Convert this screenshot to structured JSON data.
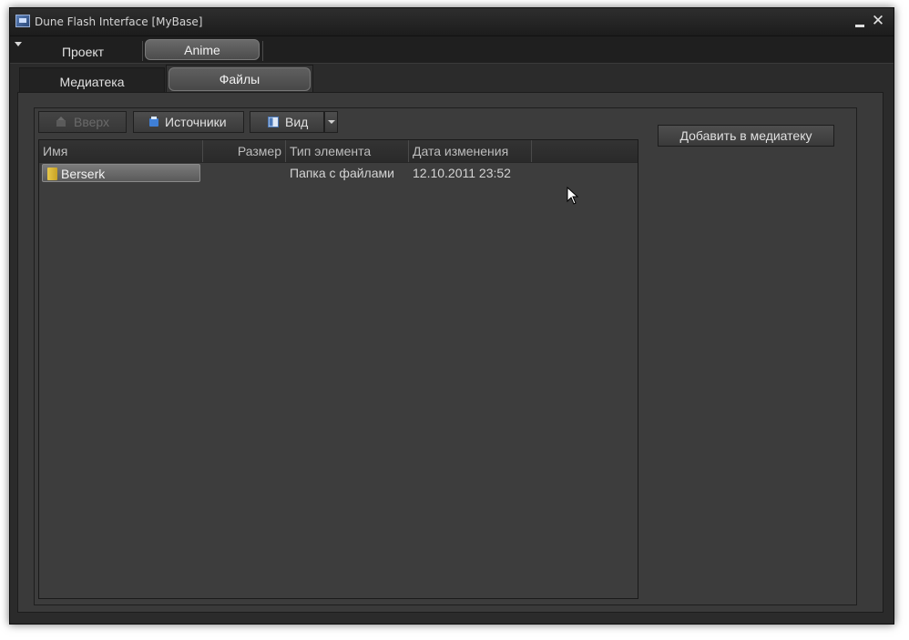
{
  "window": {
    "title": "Dune Flash Interface [MyBase]"
  },
  "menu": {
    "tabs": [
      {
        "label": "Проект"
      },
      {
        "label": "Anime"
      }
    ]
  },
  "subtabs": [
    {
      "label": "Медиатека"
    },
    {
      "label": "Файлы"
    }
  ],
  "toolbar": {
    "up_label": "Вверх",
    "sources_label": "Источники",
    "view_label": "Вид"
  },
  "table": {
    "columns": [
      "Имя",
      "Размер",
      "Тип элемента",
      "Дата изменения"
    ],
    "rows": [
      {
        "name": "Berserk",
        "size": "",
        "type": "Папка с файлами",
        "date": "12.10.2011 23:52"
      }
    ]
  },
  "side": {
    "add_label": "Добавить в медиатеку"
  },
  "colors": {
    "background": "#2b2b2b",
    "panel": "#3c3c3c",
    "folder": "#e7c84a"
  }
}
